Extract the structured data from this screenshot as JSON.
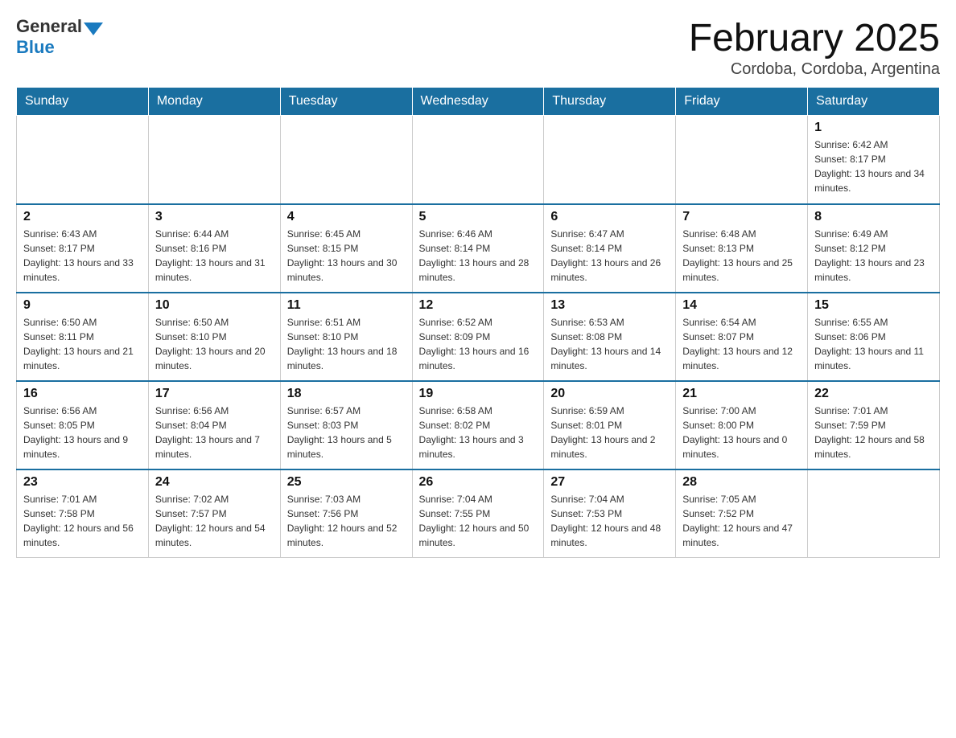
{
  "header": {
    "logo_general": "General",
    "logo_blue": "Blue",
    "title": "February 2025",
    "subtitle": "Cordoba, Cordoba, Argentina"
  },
  "days_of_week": [
    "Sunday",
    "Monday",
    "Tuesday",
    "Wednesday",
    "Thursday",
    "Friday",
    "Saturday"
  ],
  "weeks": [
    [
      {
        "day": "",
        "info": ""
      },
      {
        "day": "",
        "info": ""
      },
      {
        "day": "",
        "info": ""
      },
      {
        "day": "",
        "info": ""
      },
      {
        "day": "",
        "info": ""
      },
      {
        "day": "",
        "info": ""
      },
      {
        "day": "1",
        "info": "Sunrise: 6:42 AM\nSunset: 8:17 PM\nDaylight: 13 hours and 34 minutes."
      }
    ],
    [
      {
        "day": "2",
        "info": "Sunrise: 6:43 AM\nSunset: 8:17 PM\nDaylight: 13 hours and 33 minutes."
      },
      {
        "day": "3",
        "info": "Sunrise: 6:44 AM\nSunset: 8:16 PM\nDaylight: 13 hours and 31 minutes."
      },
      {
        "day": "4",
        "info": "Sunrise: 6:45 AM\nSunset: 8:15 PM\nDaylight: 13 hours and 30 minutes."
      },
      {
        "day": "5",
        "info": "Sunrise: 6:46 AM\nSunset: 8:14 PM\nDaylight: 13 hours and 28 minutes."
      },
      {
        "day": "6",
        "info": "Sunrise: 6:47 AM\nSunset: 8:14 PM\nDaylight: 13 hours and 26 minutes."
      },
      {
        "day": "7",
        "info": "Sunrise: 6:48 AM\nSunset: 8:13 PM\nDaylight: 13 hours and 25 minutes."
      },
      {
        "day": "8",
        "info": "Sunrise: 6:49 AM\nSunset: 8:12 PM\nDaylight: 13 hours and 23 minutes."
      }
    ],
    [
      {
        "day": "9",
        "info": "Sunrise: 6:50 AM\nSunset: 8:11 PM\nDaylight: 13 hours and 21 minutes."
      },
      {
        "day": "10",
        "info": "Sunrise: 6:50 AM\nSunset: 8:10 PM\nDaylight: 13 hours and 20 minutes."
      },
      {
        "day": "11",
        "info": "Sunrise: 6:51 AM\nSunset: 8:10 PM\nDaylight: 13 hours and 18 minutes."
      },
      {
        "day": "12",
        "info": "Sunrise: 6:52 AM\nSunset: 8:09 PM\nDaylight: 13 hours and 16 minutes."
      },
      {
        "day": "13",
        "info": "Sunrise: 6:53 AM\nSunset: 8:08 PM\nDaylight: 13 hours and 14 minutes."
      },
      {
        "day": "14",
        "info": "Sunrise: 6:54 AM\nSunset: 8:07 PM\nDaylight: 13 hours and 12 minutes."
      },
      {
        "day": "15",
        "info": "Sunrise: 6:55 AM\nSunset: 8:06 PM\nDaylight: 13 hours and 11 minutes."
      }
    ],
    [
      {
        "day": "16",
        "info": "Sunrise: 6:56 AM\nSunset: 8:05 PM\nDaylight: 13 hours and 9 minutes."
      },
      {
        "day": "17",
        "info": "Sunrise: 6:56 AM\nSunset: 8:04 PM\nDaylight: 13 hours and 7 minutes."
      },
      {
        "day": "18",
        "info": "Sunrise: 6:57 AM\nSunset: 8:03 PM\nDaylight: 13 hours and 5 minutes."
      },
      {
        "day": "19",
        "info": "Sunrise: 6:58 AM\nSunset: 8:02 PM\nDaylight: 13 hours and 3 minutes."
      },
      {
        "day": "20",
        "info": "Sunrise: 6:59 AM\nSunset: 8:01 PM\nDaylight: 13 hours and 2 minutes."
      },
      {
        "day": "21",
        "info": "Sunrise: 7:00 AM\nSunset: 8:00 PM\nDaylight: 13 hours and 0 minutes."
      },
      {
        "day": "22",
        "info": "Sunrise: 7:01 AM\nSunset: 7:59 PM\nDaylight: 12 hours and 58 minutes."
      }
    ],
    [
      {
        "day": "23",
        "info": "Sunrise: 7:01 AM\nSunset: 7:58 PM\nDaylight: 12 hours and 56 minutes."
      },
      {
        "day": "24",
        "info": "Sunrise: 7:02 AM\nSunset: 7:57 PM\nDaylight: 12 hours and 54 minutes."
      },
      {
        "day": "25",
        "info": "Sunrise: 7:03 AM\nSunset: 7:56 PM\nDaylight: 12 hours and 52 minutes."
      },
      {
        "day": "26",
        "info": "Sunrise: 7:04 AM\nSunset: 7:55 PM\nDaylight: 12 hours and 50 minutes."
      },
      {
        "day": "27",
        "info": "Sunrise: 7:04 AM\nSunset: 7:53 PM\nDaylight: 12 hours and 48 minutes."
      },
      {
        "day": "28",
        "info": "Sunrise: 7:05 AM\nSunset: 7:52 PM\nDaylight: 12 hours and 47 minutes."
      },
      {
        "day": "",
        "info": ""
      }
    ]
  ]
}
